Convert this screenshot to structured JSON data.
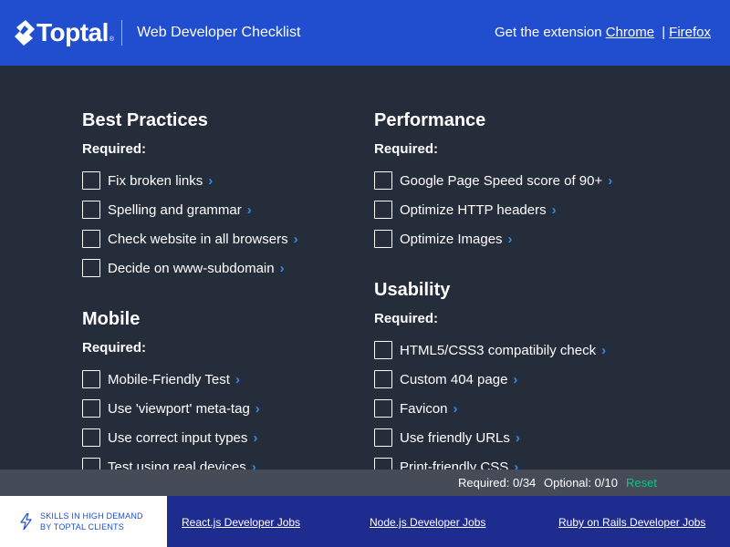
{
  "header": {
    "logo_text": "Toptal",
    "logo_reg": "®",
    "app_title": "Web Developer Checklist",
    "extension_prefix": "Get the extension",
    "extension_links": [
      "Chrome",
      "Firefox"
    ],
    "separator": "|",
    "colors": {
      "background": "#204ecf"
    }
  },
  "sections_left": [
    {
      "title": "Best Practices",
      "required_label": "Required:",
      "items": [
        "Fix broken links",
        "Spelling and grammar",
        "Check website in all browsers",
        "Decide on www-subdomain"
      ]
    },
    {
      "title": "Mobile",
      "required_label": "Required:",
      "items": [
        "Mobile-Friendly Test",
        "Use 'viewport' meta-tag",
        "Use correct input types",
        "Test using real devices"
      ]
    }
  ],
  "sections_right": [
    {
      "title": "Performance",
      "required_label": "Required:",
      "items": [
        "Google Page Speed score of 90+",
        "Optimize HTTP headers",
        "Optimize Images"
      ]
    },
    {
      "title": "Usability",
      "required_label": "Required:",
      "items": [
        "HTML5/CSS3 compatibily check",
        "Custom 404 page",
        "Favicon",
        "Use friendly URLs",
        "Print-friendly CSS"
      ]
    }
  ],
  "status": {
    "required": "Required: 0/34",
    "optional": "Optional: 0/10",
    "reset": "Reset",
    "colors": {
      "reset": "#00cc83",
      "background": "#454b57"
    }
  },
  "footer": {
    "skills_line1": "SKILLS IN HIGH DEMAND",
    "skills_line2": "BY TOPTAL CLIENTS",
    "jobs": [
      "React.js Developer Jobs",
      "Node.js Developer Jobs",
      "Ruby on Rails Developer Jobs"
    ],
    "icon": "bolt-icon",
    "colors": {
      "background": "#1f2c8f",
      "accent": "#2f8cf1"
    }
  }
}
